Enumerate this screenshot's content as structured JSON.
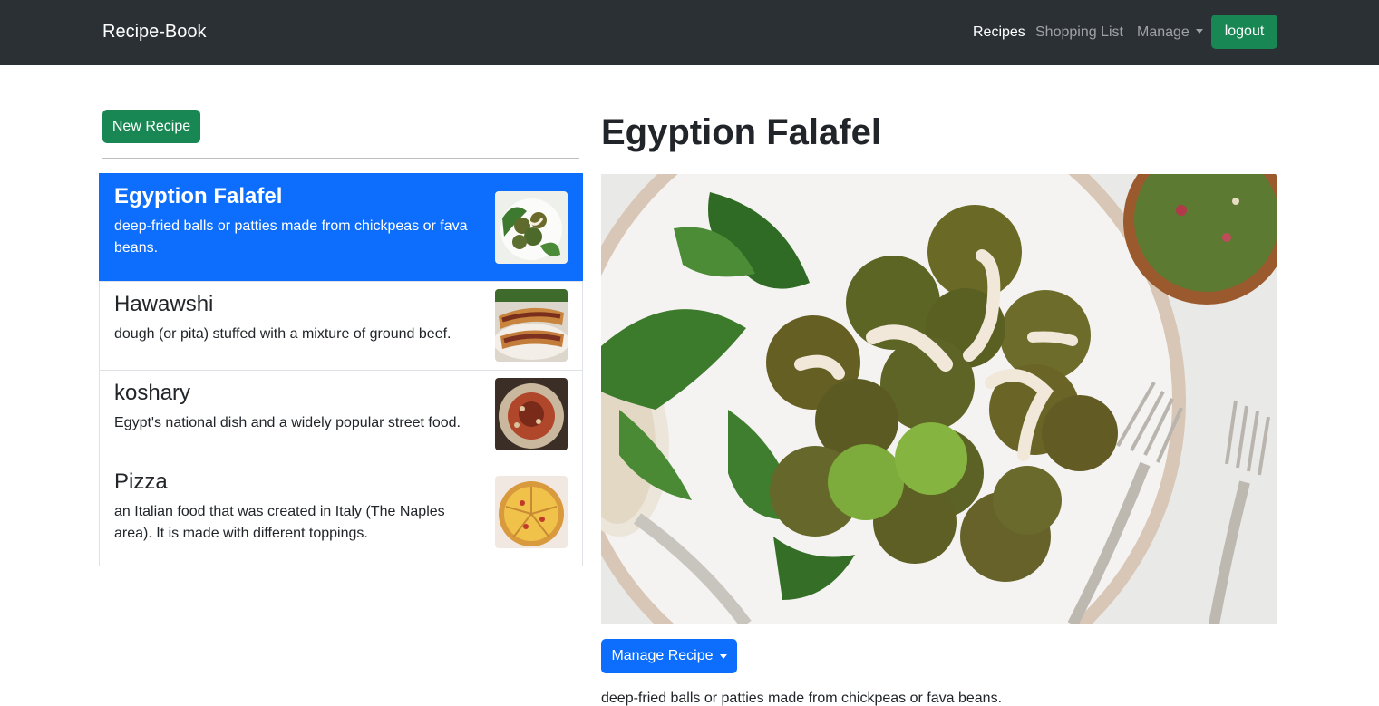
{
  "navbar": {
    "brand": "Recipe-Book",
    "links": [
      "Recipes",
      "Shopping List",
      "Manage"
    ],
    "logout_label": "logout"
  },
  "sidebar": {
    "new_button": "New Recipe",
    "recipes": [
      {
        "name": "Egyption Falafel",
        "description": "deep-fried balls or patties made from chickpeas or fava beans.",
        "image": "falafel-photo"
      },
      {
        "name": "Hawawshi",
        "description": "dough (or pita) stuffed with a mixture of ground beef.",
        "image": "hawawshi-photo"
      },
      {
        "name": "koshary",
        "description": "Egypt's national dish and a widely popular street food.",
        "image": "koshary-photo"
      },
      {
        "name": "Pizza",
        "description": "an Italian food that was created in Italy (The Naples area). It is made with different toppings.",
        "image": "pizza-photo"
      }
    ],
    "active_index": 0
  },
  "detail": {
    "title": "Egyption Falafel",
    "image": "falafel-plate-photo",
    "manage_button": "Manage Recipe",
    "description": "deep-fried balls or patties made from chickpeas or fava beans."
  },
  "colors": {
    "navbar": "#2b3035",
    "success": "#198754",
    "primary": "#0d6efd"
  }
}
